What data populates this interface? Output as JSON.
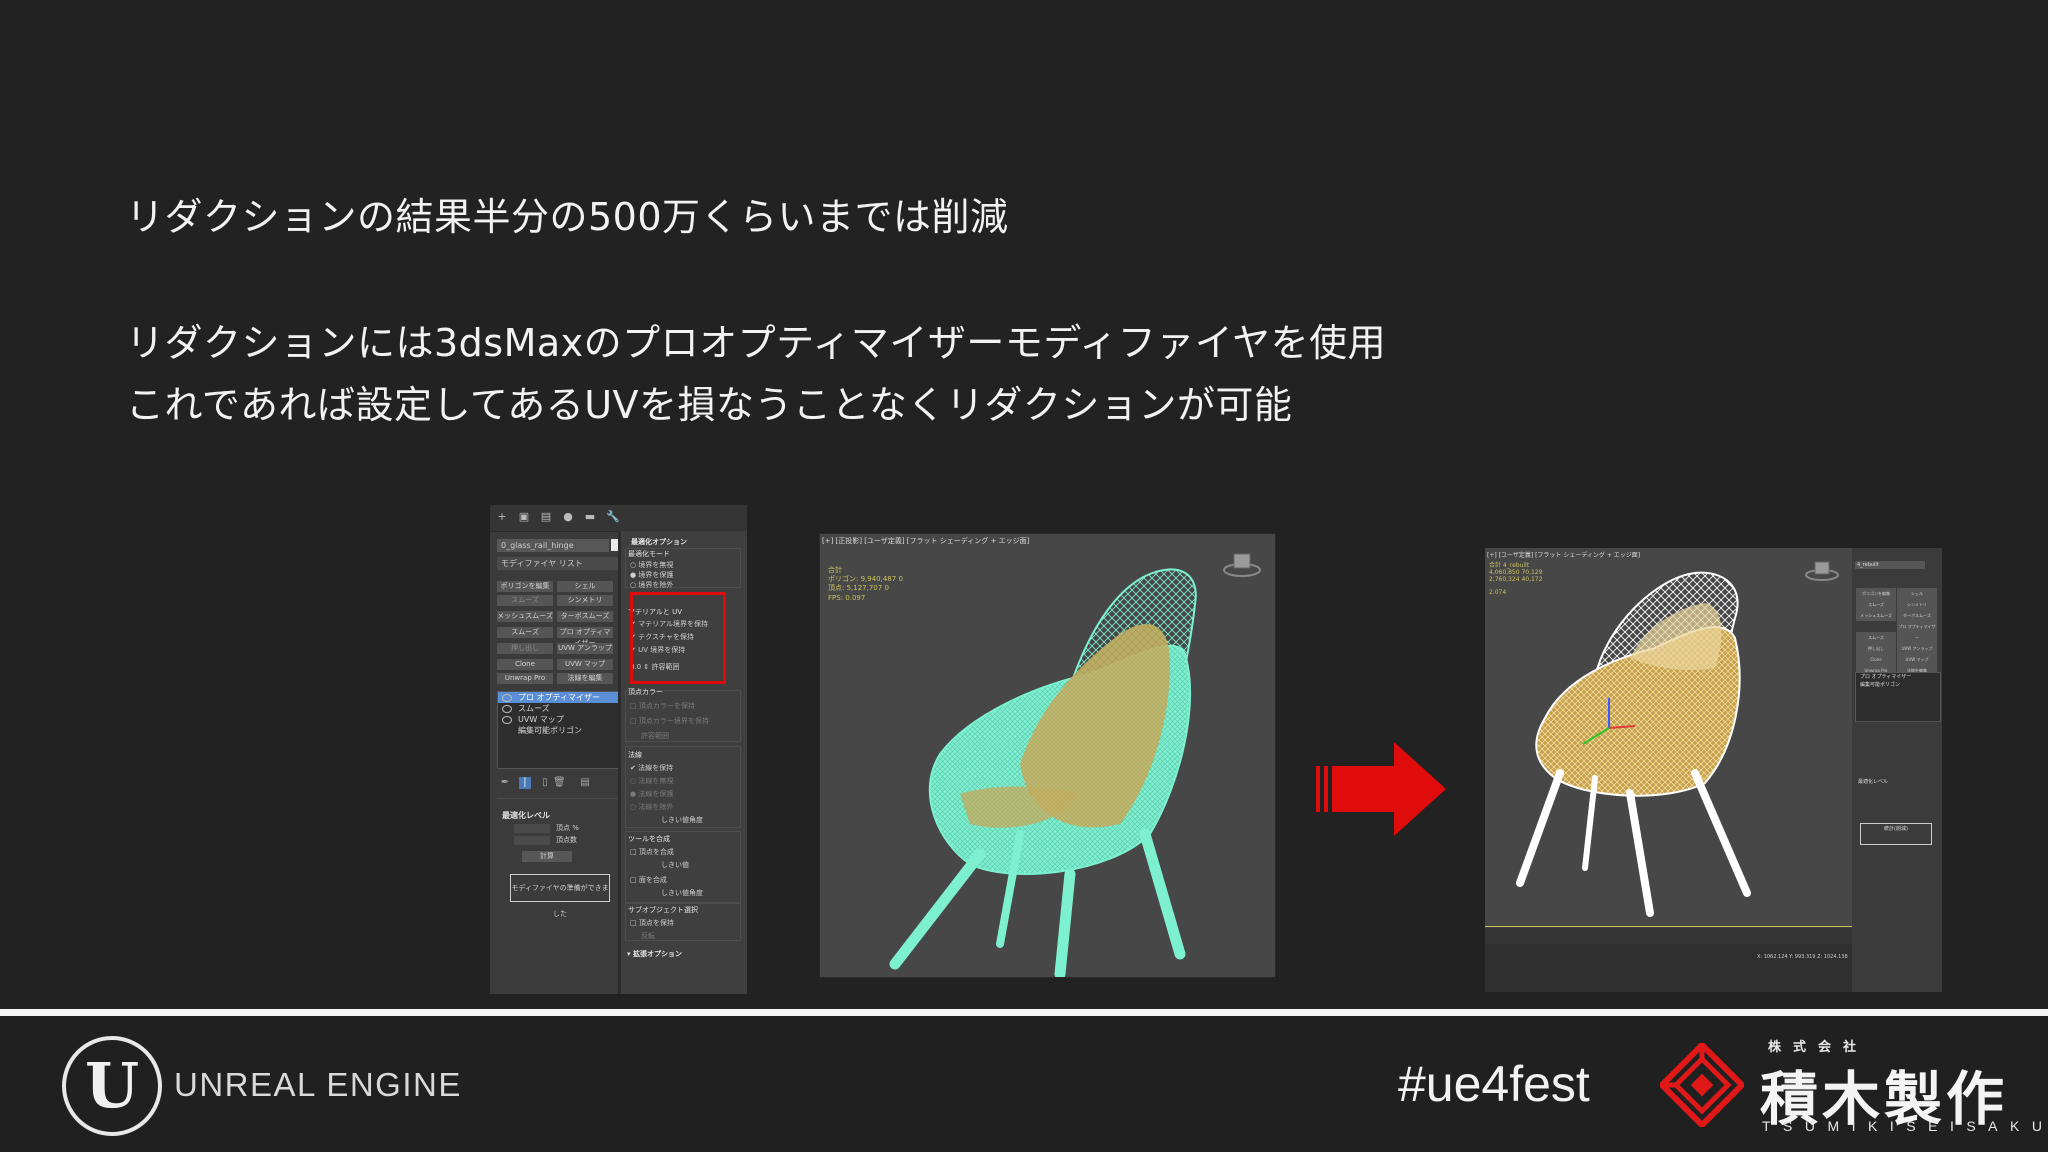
{
  "slide": {
    "line1": "リダクションの結果半分の500万くらいまでは削減",
    "line2": "リダクションには3dsMaxのプロオプティマイザーモディファイヤを使用",
    "line3": "これであれば設定してあるUVを損なうことなくリダクションが可能"
  },
  "max_panel": {
    "object_name": "0_glass_rail_hinge",
    "modifier_list": "モディファイヤ リスト",
    "buttons": [
      {
        "label": "ポリゴンを編集"
      },
      {
        "label": "シェル"
      },
      {
        "label": "スムーズ"
      },
      {
        "label": "シンメトリ"
      },
      {
        "label": "メッシュスムーズ"
      },
      {
        "label": "ターボスムーズ"
      },
      {
        "label": "スムーズ"
      },
      {
        "label": "プロ オプティマイザー"
      },
      {
        "label": "押し出し"
      },
      {
        "label": "UVW アンラップ"
      },
      {
        "label": "Clone"
      },
      {
        "label": "UVW マップ"
      },
      {
        "label": "Unwrap Pro"
      },
      {
        "label": "法線を編集"
      }
    ],
    "stack": [
      {
        "label": "プロ オプティマイザー",
        "selected": true
      },
      {
        "label": "スムーズ",
        "selected": false
      },
      {
        "label": "UVW マップ",
        "selected": false
      },
      {
        "label": "編集可能ポリゴン",
        "selected": false
      }
    ],
    "opt_level": {
      "header": "最適化レベル",
      "vertex_pct": "頂点 %",
      "vertex_count": "頂点数",
      "calc": "計算",
      "status": "モディファイヤの準備ができました"
    },
    "right": {
      "header": "最適化オプション",
      "mode_title": "最適化モード",
      "mode_items": [
        "境界を無視",
        "境界を保護",
        "境界を除外"
      ],
      "uv_title": "マテリアルと UV",
      "uv_items": [
        "マテリアル境界を保持",
        "テクスチャを保持",
        "UV 境界を保持"
      ],
      "uv_tolerance_value": "0.0",
      "uv_tolerance_label": "許容範囲",
      "vc_title": "頂点カラー",
      "vc_items": [
        "頂点カラーを保持",
        "頂点カラー境界を保持"
      ],
      "vc_tolerance": "許容範囲",
      "normals_title": "法線",
      "normals_items": [
        "法線を保持",
        "法線を無視",
        "法線を保護",
        "法線を除外"
      ],
      "normals_angle": "しきい値角度",
      "merge_title": "ツールを合成",
      "merge_items": [
        "頂点を合成",
        "しきい値",
        "面を合成",
        "しきい値角度"
      ],
      "subobj_title": "サブオブジェクト選択",
      "subobj_items": [
        "頂点を保持",
        "反転"
      ],
      "extra_header": "拡張オプション"
    }
  },
  "viewport_before": {
    "label": "[+] [正投影] [ユーザ定義] [フラット シェーディング + エッジ面]",
    "stats": [
      {
        "k": "合計",
        "v": ""
      },
      {
        "k": "ポリゴン:",
        "v": "9,940,487 0"
      },
      {
        "k": "頂点:",
        "v": "5,127,707 0"
      }
    ],
    "fps": "FPS: 0.097"
  },
  "viewport_after": {
    "label": "[+] [ユーザ定義] [フラット シェーディング + エッジ面]",
    "stats": [
      {
        "k": "合計",
        "v": "4_rebuilt"
      },
      {
        "k": "",
        "v": "4,060,850 70,129"
      },
      {
        "k": "",
        "v": "2,760,324 40,172"
      }
    ],
    "fps": "2.074",
    "side_obj": "4_rebuilt",
    "side_buttons": [
      "ポリゴンを編集",
      "シェル",
      "スムーズ",
      "シンメトリ",
      "メッシュスムーズ",
      "ターボスムーズ",
      "スムーズ",
      "プロ オプティマイザー",
      "押し出し",
      "UVW アンラップ",
      "Clone",
      "UVW マップ",
      "Unwrap Pro",
      "法線を編集"
    ],
    "side_stack": [
      "プロ オプティマイザー",
      "編集可能ポリゴン"
    ],
    "side_level": "最適化レベル",
    "side_result": "統計(削減)",
    "status": "X: 1062.124 Y: 993.319 Z: 1024.138"
  },
  "footer": {
    "ue_text": "UNREAL ENGINE",
    "hashtag": "#ue4fest",
    "company_sub": "株式会社",
    "company_name": "積木製作",
    "company_roman": "TSUMIKISEISAKU"
  },
  "colors": {
    "background": "#222223",
    "accent_red": "#e00b0b",
    "mesh_cyan": "#7df0d0",
    "mesh_gold": "#c8a14a",
    "stats_yellow": "#c9c35a"
  }
}
